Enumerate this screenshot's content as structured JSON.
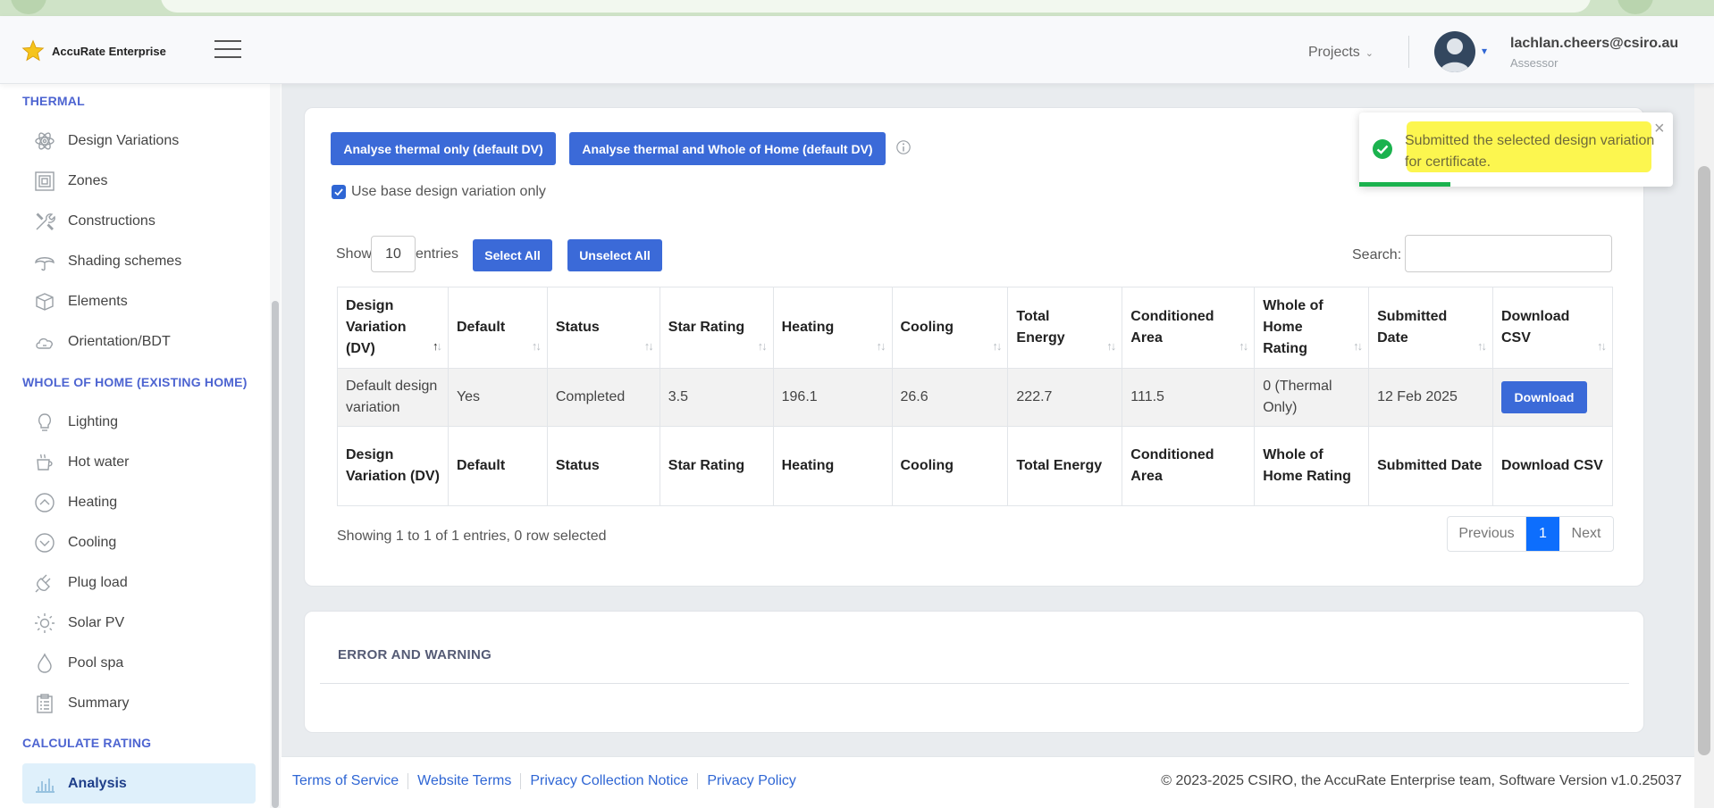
{
  "app": {
    "brand_name": "AccuRate Enterprise"
  },
  "header": {
    "projects_label": "Projects",
    "user_email": "lachlan.cheers@csiro.au",
    "user_role": "Assessor"
  },
  "sidebar": {
    "thermal_section": "THERMAL",
    "thermal_items": [
      {
        "label": "Design Variations",
        "icon": "atom-icon"
      },
      {
        "label": "Zones",
        "icon": "zones-icon"
      },
      {
        "label": "Constructions",
        "icon": "tools-icon"
      },
      {
        "label": "Shading schemes",
        "icon": "umbrella-icon"
      },
      {
        "label": "Elements",
        "icon": "box-icon"
      },
      {
        "label": "Orientation/BDT",
        "icon": "cloud-icon"
      }
    ],
    "whole_home_section": "WHOLE OF HOME (EXISTING HOME)",
    "whole_home_items": [
      {
        "label": "Lighting",
        "icon": "lightbulb-icon"
      },
      {
        "label": "Hot water",
        "icon": "cup-icon"
      },
      {
        "label": "Heating",
        "icon": "heating-icon"
      },
      {
        "label": "Cooling",
        "icon": "cooling-icon"
      },
      {
        "label": "Plug load",
        "icon": "plug-icon"
      },
      {
        "label": "Solar PV",
        "icon": "sun-icon"
      },
      {
        "label": "Pool spa",
        "icon": "drop-icon"
      },
      {
        "label": "Summary",
        "icon": "clipboard-icon"
      }
    ],
    "calculate_section": "CALCULATE RATING",
    "active_item": {
      "label": "Analysis",
      "icon": "bar-chart-icon"
    }
  },
  "analysis": {
    "btn_thermal_only": "Analyse thermal only (default DV)",
    "btn_thermal_whole": "Analyse thermal and Whole of Home (default DV)",
    "use_base_label": "Use base design variation only",
    "use_base_checked": true,
    "show_label": "Show",
    "entries_value": "10",
    "entries_label": "entries",
    "select_all": "Select All",
    "unselect_all": "Unselect All",
    "search_label": "Search:",
    "search_value": "",
    "columns": [
      "Design Variation (DV)",
      "Default",
      "Status",
      "Star Rating",
      "Heating",
      "Cooling",
      "Total Energy",
      "Conditioned Area",
      "Whole of Home Rating",
      "Submitted Date",
      "Download CSV"
    ],
    "rows": [
      {
        "dv": "Default design variation",
        "default": "Yes",
        "status": "Completed",
        "star_rating": "3.5",
        "heating": "196.1",
        "cooling": "26.6",
        "total_energy": "222.7",
        "conditioned_area": "111.5",
        "whole_home_rating": "0 (Thermal Only)",
        "submitted_date": "12 Feb 2025",
        "download_label": "Download"
      }
    ],
    "showing_text": "Showing 1 to 1 of 1 entries, 0 row selected",
    "pagination": {
      "previous": "Previous",
      "current_page": "1",
      "next": "Next"
    }
  },
  "error_panel": {
    "title": "ERROR AND WARNING"
  },
  "toast": {
    "message": "Submitted the selected design variation for certificate.",
    "close_symbol": "×",
    "progress": 0.29
  },
  "footer": {
    "links": [
      "Terms of Service",
      "Website Terms",
      "Privacy Collection Notice",
      "Privacy Policy"
    ],
    "copyright": "© 2023-2025 CSIRO, the AccuRate Enterprise team, Software Version v1.0.25037"
  },
  "colors": {
    "primary_button": "#3b6ad8",
    "section_heading": "#4d64d1",
    "active_page": "#0d6efd",
    "success": "#1bb24e",
    "highlight": "#fcf64f"
  }
}
